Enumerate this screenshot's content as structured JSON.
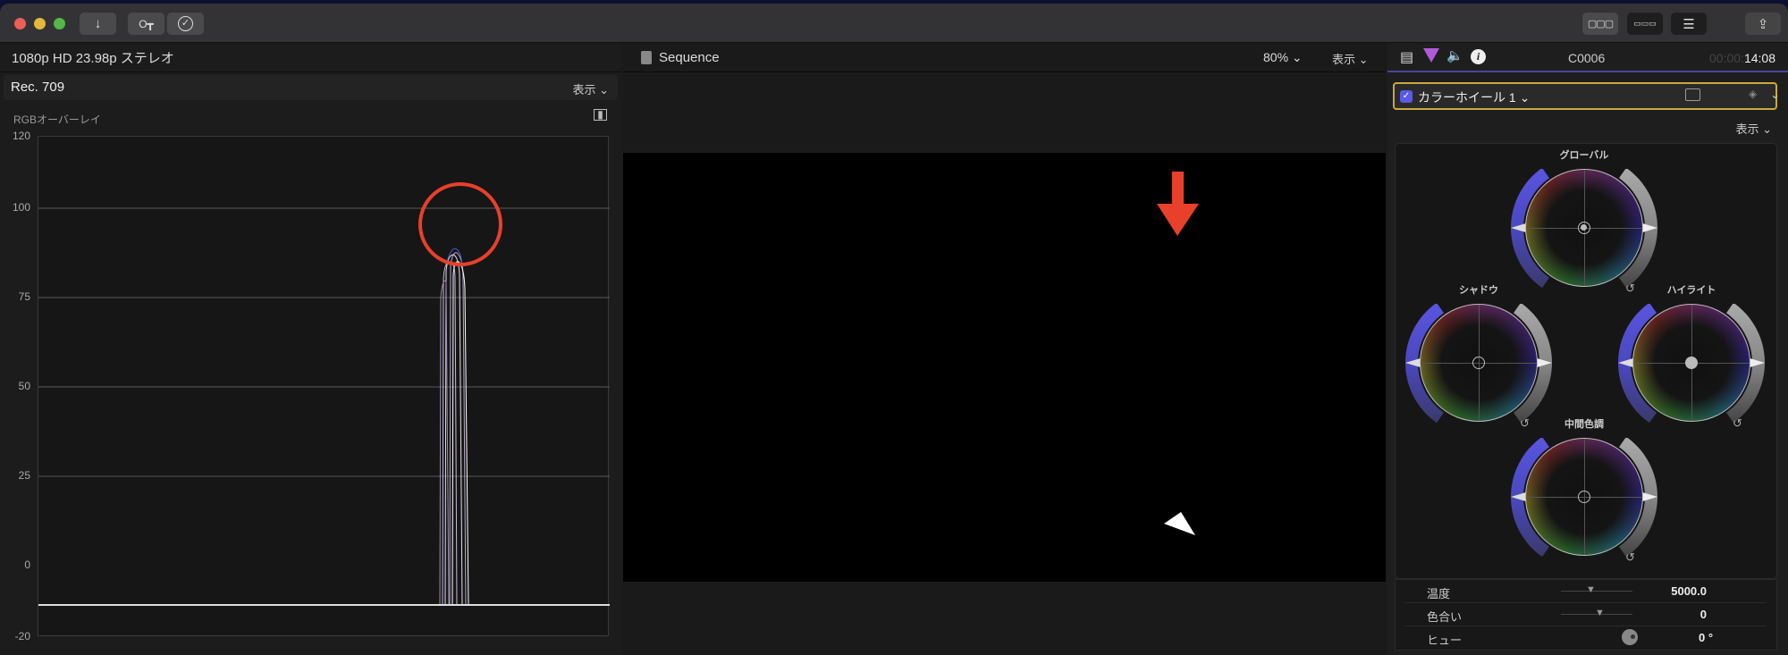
{
  "toolbar": {
    "import_icon": "arrow-down-icon",
    "keyword_icon": "key-icon",
    "analyze_icon": "checkmark-circle-icon",
    "share_icon": "share-icon"
  },
  "library": {
    "format": "1080p HD 23.98p ステレオ"
  },
  "scope": {
    "colorspace": "Rec. 709",
    "view_label": "表示",
    "mode": "RGBオーバーレイ",
    "y_ticks": [
      "120",
      "100",
      "75",
      "50",
      "25",
      "0",
      "-20"
    ]
  },
  "viewer": {
    "title": "Sequence",
    "zoom": "80%",
    "view_label": "表示"
  },
  "inspector": {
    "clip": "C0006",
    "timecode_dim": "00:00:",
    "timecode": "14:08",
    "effect": "カラーホイール 1",
    "effect_enabled": true,
    "view_label": "表示",
    "wheels": [
      {
        "label": "グローバル"
      },
      {
        "label": "シャドウ"
      },
      {
        "label": "ハイライト"
      },
      {
        "label": "中間色調"
      }
    ],
    "params": [
      {
        "label": "温度",
        "value": "5000.0"
      },
      {
        "label": "色合い",
        "value": "0"
      },
      {
        "label": "ヒュー",
        "value": "0 °"
      }
    ]
  },
  "colors": {
    "annotation": "#e8402a",
    "accent_border": "#c9a93c",
    "checkbox": "#5a5ae6"
  }
}
